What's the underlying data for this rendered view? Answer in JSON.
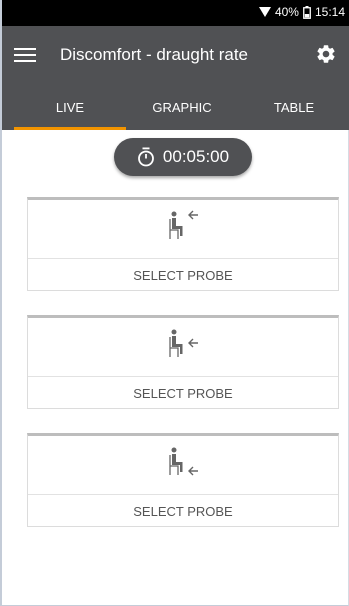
{
  "status_bar": {
    "battery_percent": "40%",
    "time": "15:14",
    "icons": [
      "wifi-icon",
      "battery-icon"
    ]
  },
  "app_bar": {
    "title": "Discomfort - draught rate",
    "icons": [
      "menu-icon",
      "gear-icon"
    ]
  },
  "tabs": [
    {
      "label": "LIVE",
      "active": true
    },
    {
      "label": "GRAPHIC",
      "active": false
    },
    {
      "label": "TABLE",
      "active": false
    }
  ],
  "timer": {
    "value": "00:05:00",
    "icon": "stopwatch-icon"
  },
  "probes": [
    {
      "button_label": "SELECT PROBE",
      "icon": "seated-person-draught-icon"
    },
    {
      "button_label": "SELECT PROBE",
      "icon": "seated-person-draught-icon"
    },
    {
      "button_label": "SELECT PROBE",
      "icon": "seated-person-draught-icon"
    }
  ],
  "colors": {
    "app_bar": "#505154",
    "tab_indicator": "#f29400",
    "status_bar": "#000000"
  }
}
